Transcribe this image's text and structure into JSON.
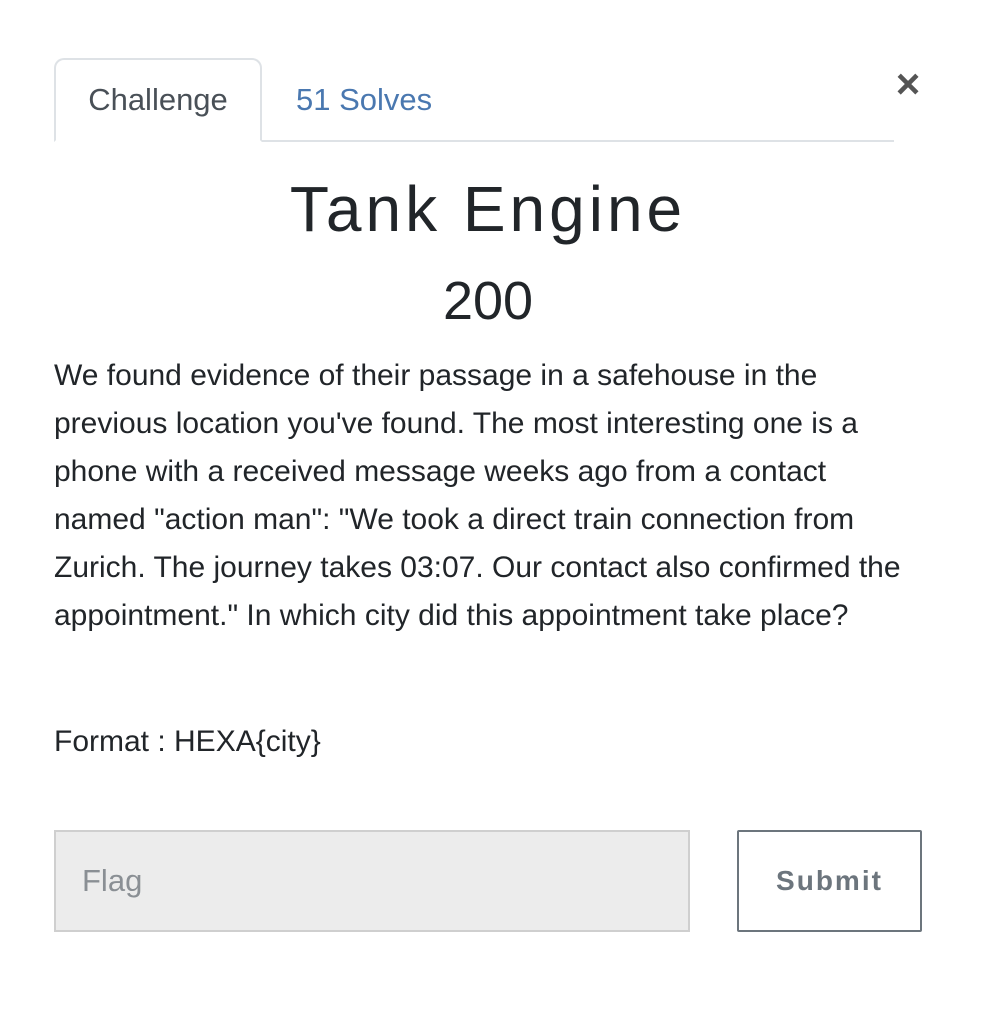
{
  "tabs": {
    "challenge_label": "Challenge",
    "solves_label": "51 Solves"
  },
  "close": {
    "symbol": "×"
  },
  "challenge": {
    "title": "Tank Engine",
    "points": "200",
    "description": "We found evidence of their passage in a safehouse in the previous location you've found. The most interesting one is a phone with a received message weeks ago from a contact named \"action man\": \"We took a direct train connection from Zurich. The journey takes 03:07. Our contact also confirmed the appointment.\" In which city did this appointment take place?",
    "format": "Format : HEXA{city}"
  },
  "form": {
    "flag_placeholder": "Flag",
    "submit_label": "Submit"
  },
  "colors": {
    "link": "#4a78b0",
    "text": "#212529",
    "input_bg": "#ececec",
    "button_border": "#6c757d"
  }
}
